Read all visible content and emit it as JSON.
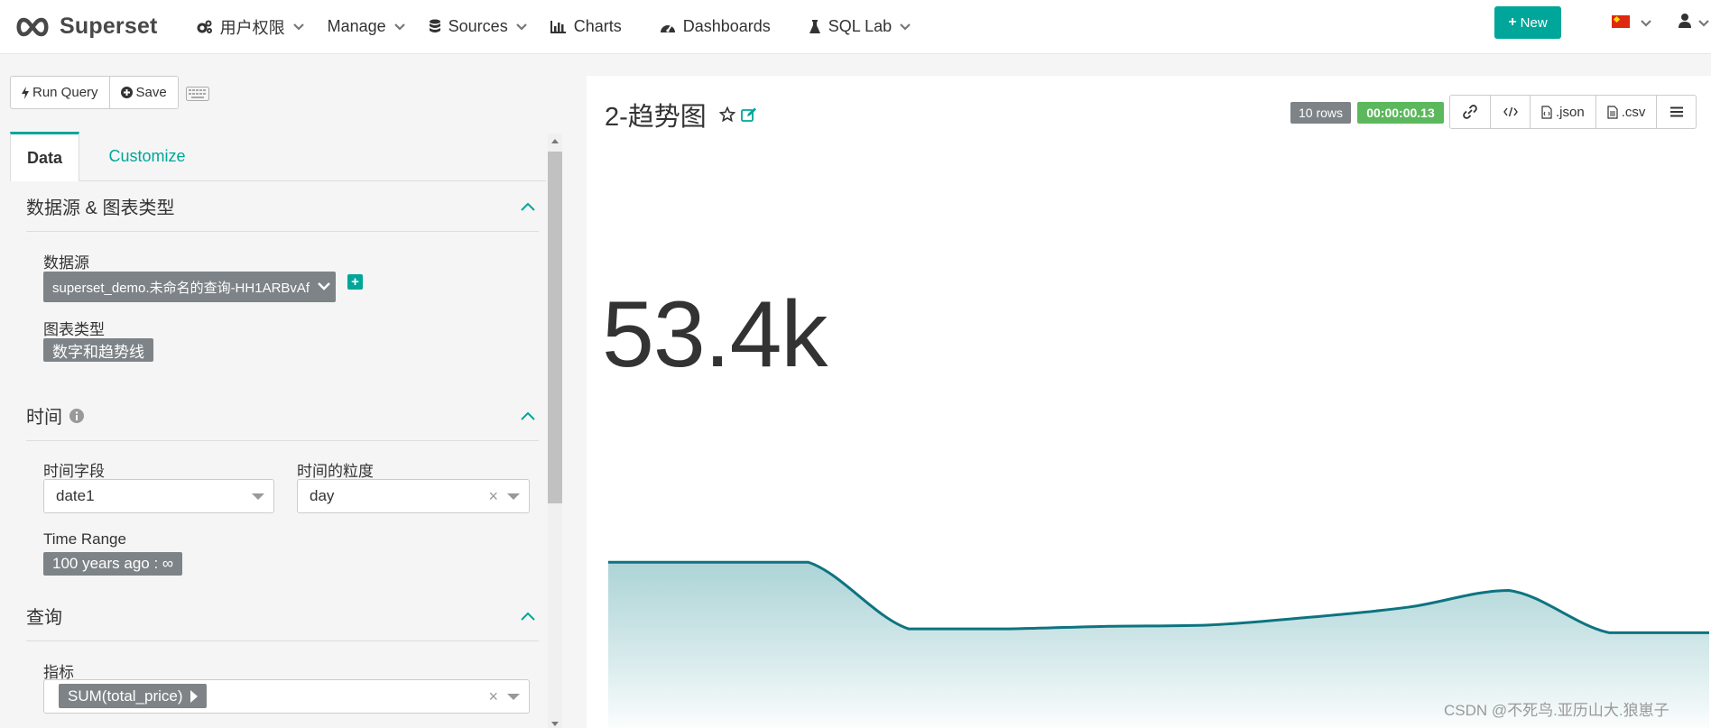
{
  "nav": {
    "brand": "Superset",
    "items": [
      {
        "label": "用户权限",
        "icon": "gears-icon",
        "has_caret": true
      },
      {
        "label": "Manage",
        "icon": "",
        "has_caret": true
      },
      {
        "label": "Sources",
        "icon": "database-icon",
        "has_caret": true
      },
      {
        "label": "Charts",
        "icon": "bar-chart-icon",
        "has_caret": false
      },
      {
        "label": "Dashboards",
        "icon": "dashboard-icon",
        "has_caret": false
      },
      {
        "label": "SQL Lab",
        "icon": "flask-icon",
        "has_caret": true
      }
    ],
    "new_button": "New",
    "language_flag": "cn-flag-icon",
    "accent_color": "#00a699"
  },
  "toolbar": {
    "run_query": "Run Query",
    "save": "Save"
  },
  "tabs": {
    "data": "Data",
    "customize": "Customize"
  },
  "sections": {
    "datasource_chart": {
      "title": "数据源 & 图表类型",
      "datasource_label": "数据源",
      "datasource_value": "superset_demo.未命名的查询-HH1ARBvAf",
      "viz_type_label": "图表类型",
      "viz_type_value": "数字和趋势线"
    },
    "time": {
      "title": "时间",
      "time_column_label": "时间字段",
      "time_column_value": "date1",
      "time_grain_label": "时间的粒度",
      "time_grain_value": "day",
      "time_range_label": "Time Range",
      "time_range_value": "100 years ago : ∞"
    },
    "query": {
      "title": "查询",
      "metrics_label": "指标",
      "metric_value": "SUM(total_price)"
    }
  },
  "chart": {
    "title": "2-趋势图",
    "rows_badge": "10 rows",
    "time_badge": "00:00:00.13",
    "actions": {
      "json": ".json",
      "csv": ".csv"
    },
    "big_number": "53.4k",
    "watermark": "CSDN @不死鸟.亚历山大.狼崽子"
  },
  "chart_data": {
    "type": "area",
    "values": [
      0.78,
      0.78,
      0.78,
      0.26,
      0.26,
      0.28,
      0.29,
      0.35,
      0.43,
      0.56,
      0.23,
      0.23
    ],
    "value_scale": "relative",
    "color": "#0d7480",
    "fill_top": "#9fcdd0",
    "fill_bottom": "#ffffff"
  }
}
